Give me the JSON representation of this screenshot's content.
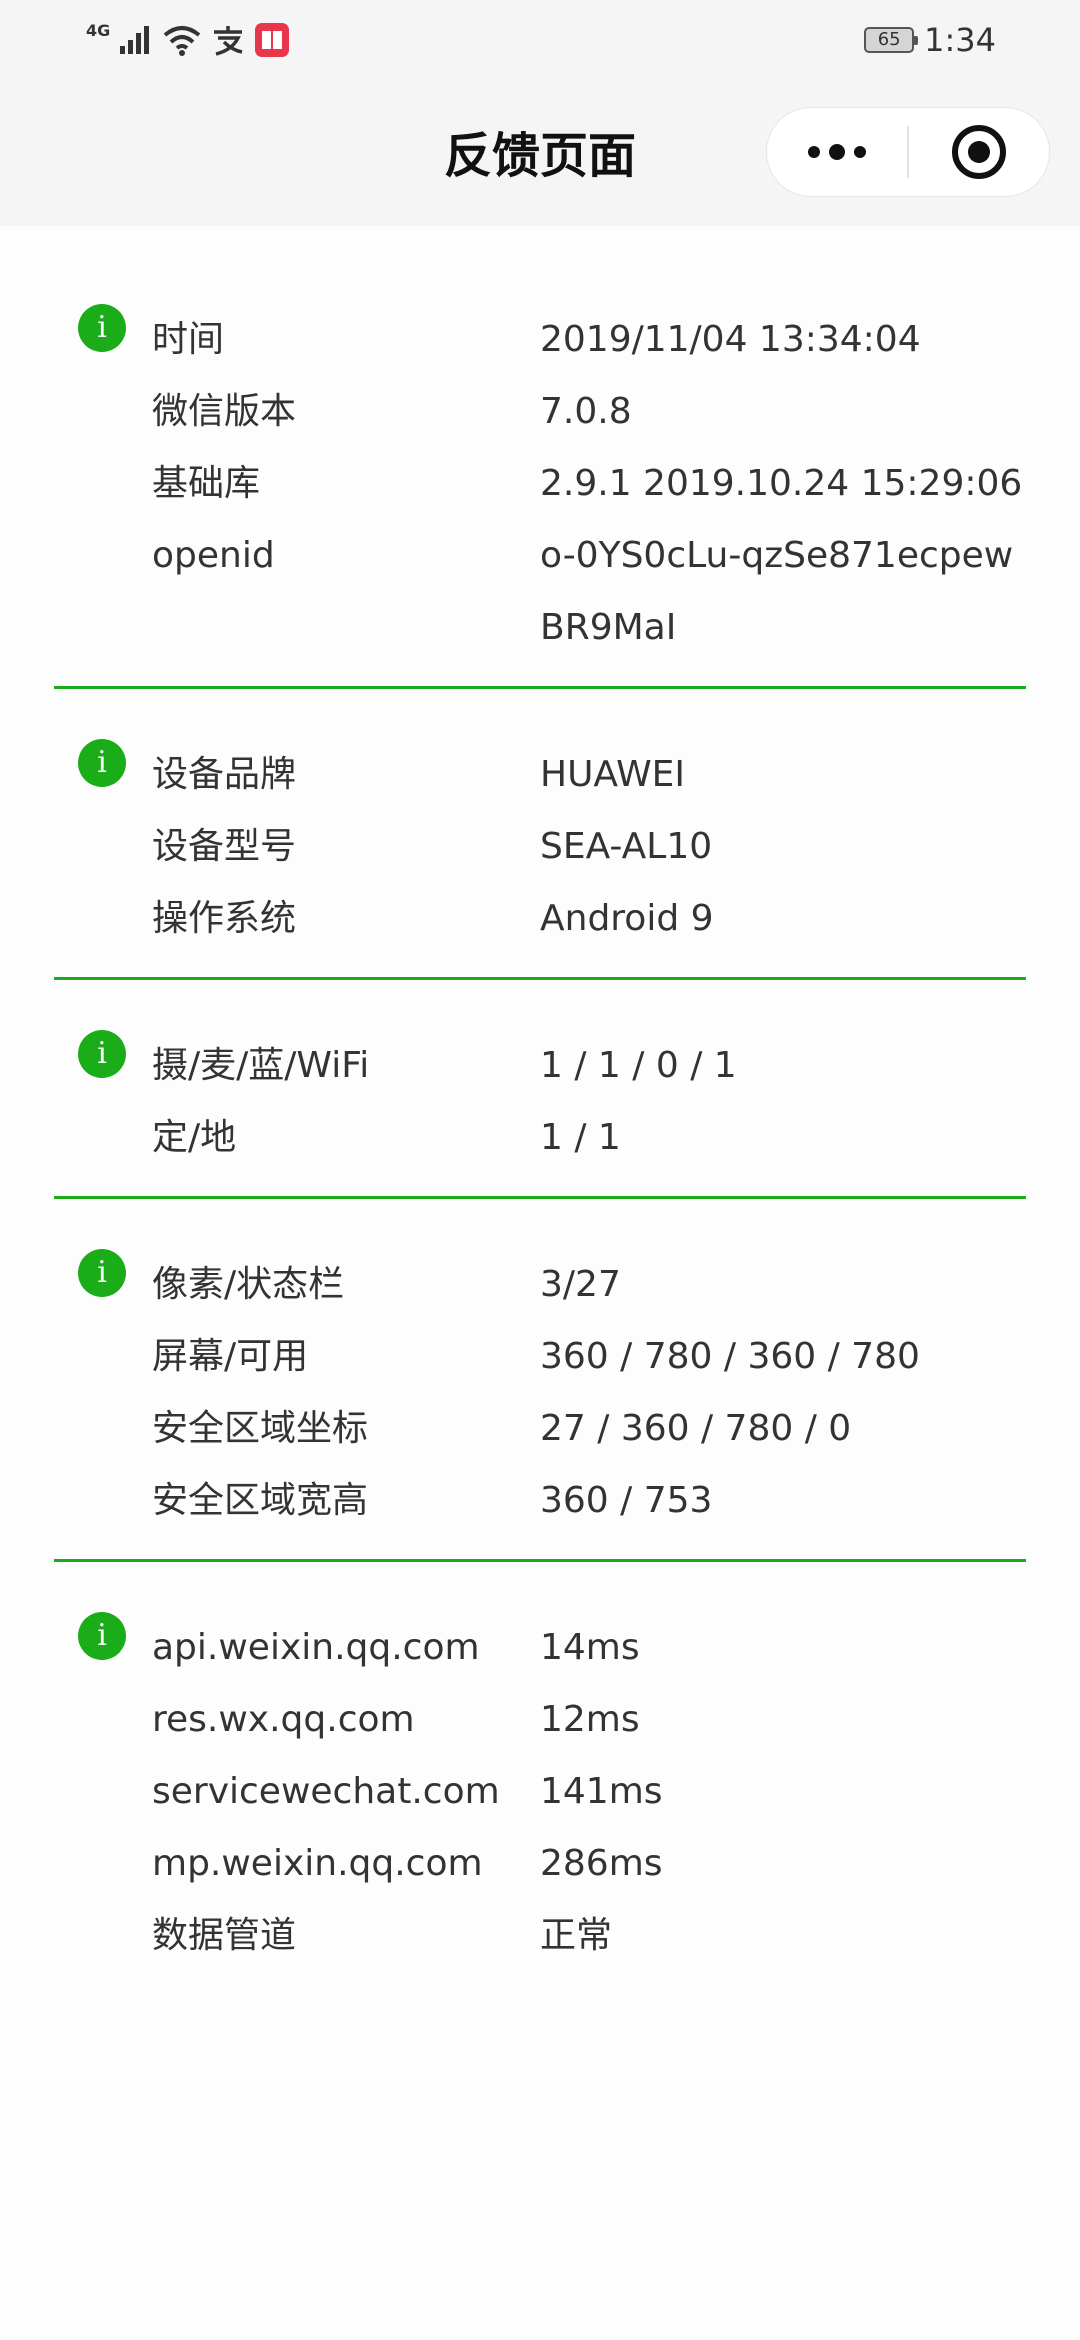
{
  "status_bar": {
    "network": "4G",
    "time": "1:34",
    "battery": "65"
  },
  "nav": {
    "title": "反馈页面",
    "more_icon": "more-dots-icon",
    "close_icon": "target-circle-icon"
  },
  "sections": [
    {
      "rows": [
        {
          "label": "时间",
          "value": "2019/11/04 13:34:04"
        },
        {
          "label": "微信版本",
          "value": "7.0.8"
        },
        {
          "label": "基础库",
          "value": "2.9.1 2019.10.24 15:29:06"
        },
        {
          "label": "openid",
          "value": "o-0YS0cLu-qzSe871ecpewBR9MaI"
        }
      ]
    },
    {
      "rows": [
        {
          "label": "设备品牌",
          "value": "HUAWEI"
        },
        {
          "label": "设备型号",
          "value": "SEA-AL10"
        },
        {
          "label": "操作系统",
          "value": "Android 9"
        }
      ]
    },
    {
      "rows": [
        {
          "label": "摄/麦/蓝/WiFi",
          "value": "1 / 1 / 0 / 1"
        },
        {
          "label": "定/地",
          "value": "1 / 1"
        }
      ]
    },
    {
      "rows": [
        {
          "label": "像素/状态栏",
          "value": "3/27"
        },
        {
          "label": "屏幕/可用",
          "value": "360 / 780 / 360 / 780"
        },
        {
          "label": "安全区域坐标",
          "value": "27 / 360 / 780 / 0"
        },
        {
          "label": "安全区域宽高",
          "value": "360 / 753"
        }
      ]
    },
    {
      "rows": [
        {
          "label": "api.weixin.qq.com",
          "value": "14ms"
        },
        {
          "label": "res.wx.qq.com",
          "value": "12ms"
        },
        {
          "label": "servicewechat.com",
          "value": "141ms"
        },
        {
          "label": "mp.weixin.qq.com",
          "value": "286ms"
        },
        {
          "label": "数据管道",
          "value": "正常"
        }
      ]
    }
  ],
  "info_icon_glyph": "i",
  "colors": {
    "accent_green": "#1aad19",
    "nav_bg": "#f5f5f5"
  }
}
